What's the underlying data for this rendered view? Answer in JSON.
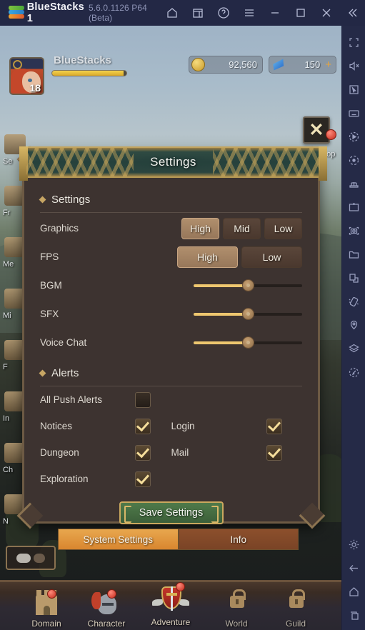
{
  "titlebar": {
    "app_name": "BlueStacks 1",
    "version": "5.6.0.1126 P64 (Beta)",
    "icons": [
      "home-icon",
      "multi-instance-icon",
      "help-icon",
      "menu-icon",
      "minimize-icon",
      "maximize-icon",
      "close-icon",
      "collapse-icon"
    ]
  },
  "sidebar": {
    "icons": [
      "fullscreen-icon",
      "mute-icon",
      "cursor-icon",
      "keyboard-controls-icon",
      "macro-record-icon",
      "rotate-icon",
      "multi-instance-manager-icon",
      "install-apk-icon",
      "screenshot-icon",
      "media-folder-icon",
      "copy-paste-icon",
      "shake-icon",
      "location-icon",
      "layers-icon",
      "eco-mode-icon"
    ],
    "bottom_icons": [
      "settings-gear-icon",
      "back-arrow-icon",
      "home-icon",
      "recents-icon"
    ]
  },
  "game_header": {
    "player_name": "BlueStacks",
    "player_level": "18",
    "gold": "92,560",
    "gems": "150",
    "gem_plus": "+"
  },
  "left_menu": [
    {
      "label": "Se"
    },
    {
      "label": "Fr"
    },
    {
      "label": "Me"
    },
    {
      "label": "Mi"
    },
    {
      "label": "F"
    },
    {
      "label": "In"
    },
    {
      "label": "Ch"
    },
    {
      "label": "N"
    }
  ],
  "shop_label": "hop",
  "close_button": {
    "glyph": "✕"
  },
  "dialog": {
    "title": "Settings",
    "sections": {
      "settings": {
        "heading": "Settings",
        "graphics": {
          "label": "Graphics",
          "options": [
            "High",
            "Mid",
            "Low"
          ],
          "selected": "High"
        },
        "fps": {
          "label": "FPS",
          "options": [
            "High",
            "Low"
          ],
          "selected": "High"
        },
        "sliders": [
          {
            "label": "BGM",
            "value": 50
          },
          {
            "label": "SFX",
            "value": 50
          },
          {
            "label": "Voice Chat",
            "value": 50
          }
        ]
      },
      "alerts": {
        "heading": "Alerts",
        "rows": [
          {
            "left_label": "All Push Alerts",
            "left_checked": false,
            "right_label": "",
            "right_checked": null
          },
          {
            "left_label": "Notices",
            "left_checked": true,
            "right_label": "Login",
            "right_checked": true
          },
          {
            "left_label": "Dungeon",
            "left_checked": true,
            "right_label": "Mail",
            "right_checked": true
          },
          {
            "left_label": "Exploration",
            "left_checked": true,
            "right_label": "",
            "right_checked": null
          }
        ]
      }
    },
    "save_button": "Save Settings"
  },
  "tabs": [
    {
      "label": "System Settings",
      "active": true
    },
    {
      "label": "Info",
      "active": false
    }
  ],
  "bottom_nav": [
    {
      "label": "Domain",
      "icon": "castle-icon",
      "badge": true,
      "locked": false
    },
    {
      "label": "Character",
      "icon": "helmet-icon",
      "badge": true,
      "locked": false
    },
    {
      "label": "Adventure",
      "icon": "shield-sword-icon",
      "badge": true,
      "locked": false
    },
    {
      "label": "World",
      "icon": "lock-icon",
      "badge": false,
      "locked": true
    },
    {
      "label": "Guild",
      "icon": "lock-icon",
      "badge": false,
      "locked": true
    }
  ],
  "colors": {
    "titlebar_bg": "#232845",
    "sidebar_bg": "#252a47",
    "dialog_bg": "#3d3330",
    "dialog_border": "#6d5a44",
    "banner_gold": "#c2a45e",
    "banner_teal": "#26413c",
    "accent_selected": "#b08f6d",
    "slider_fill": "#eec76f",
    "save_green": "#4f7a4a",
    "tab_active": "#e8a74e",
    "tab_inactive": "#8c4f2c",
    "badge_red": "#c32a1c"
  }
}
